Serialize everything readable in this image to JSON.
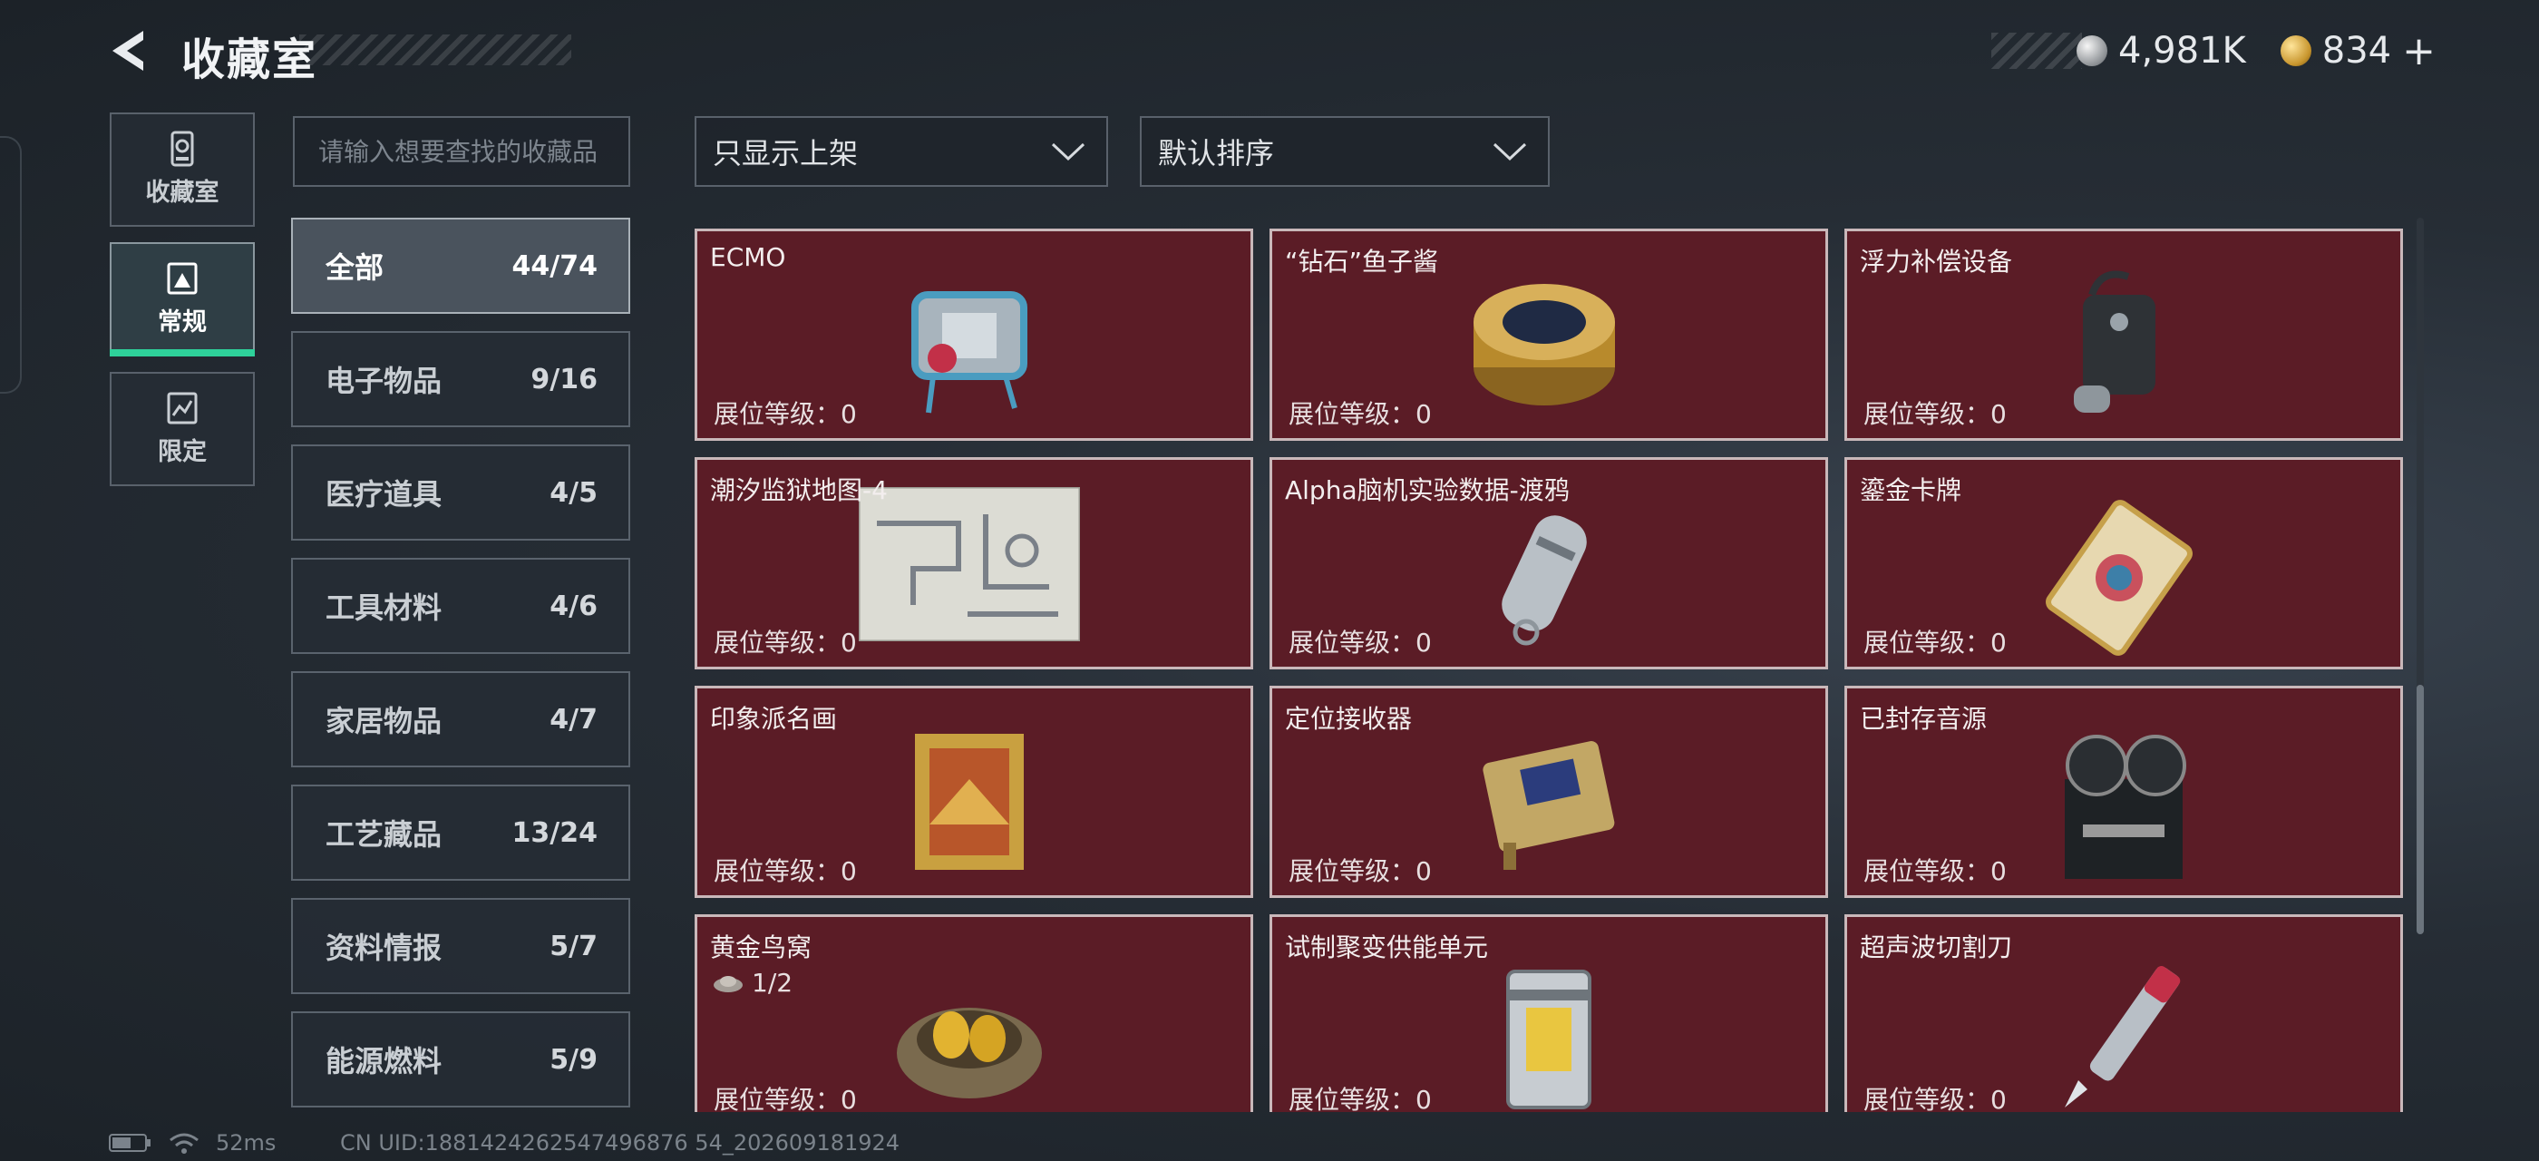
{
  "header": {
    "title": "收藏室",
    "currency": [
      {
        "icon": "silver-coin-icon",
        "value": "4,981K"
      },
      {
        "icon": "gold-coin-icon",
        "value": "834"
      }
    ],
    "add_symbol": "+"
  },
  "left_nav": [
    {
      "label": "收藏室",
      "icon": "collection-room-icon",
      "active": false
    },
    {
      "label": "常规",
      "icon": "regular-icon",
      "active": true
    },
    {
      "label": "限定",
      "icon": "limited-icon",
      "active": false
    }
  ],
  "search": {
    "placeholder": "请输入想要查找的收藏品",
    "value": ""
  },
  "categories": [
    {
      "name": "全部",
      "count": "44/74",
      "active": true
    },
    {
      "name": "电子物品",
      "count": "9/16"
    },
    {
      "name": "医疗道具",
      "count": "4/5"
    },
    {
      "name": "工具材料",
      "count": "4/6"
    },
    {
      "name": "家居物品",
      "count": "4/7"
    },
    {
      "name": "工艺藏品",
      "count": "13/24"
    },
    {
      "name": "资料情报",
      "count": "5/7"
    },
    {
      "name": "能源燃料",
      "count": "5/9"
    }
  ],
  "filters": {
    "listing": "只显示上架",
    "sort": "默认排序"
  },
  "level_label": "展位等级：0",
  "items": [
    {
      "name": "ECMO",
      "icon": "ecmo-machine-icon"
    },
    {
      "name": "“钻石”鱼子酱",
      "icon": "caviar-tin-icon"
    },
    {
      "name": "浮力补偿设备",
      "icon": "buoyancy-device-icon"
    },
    {
      "name": "潮汐监狱地图-4",
      "icon": "prison-map-icon"
    },
    {
      "name": "Alpha脑机实验数据-渡鸦",
      "icon": "data-capsule-icon"
    },
    {
      "name": "鎏金卡牌",
      "icon": "gilded-card-icon"
    },
    {
      "name": "印象派名画",
      "icon": "framed-painting-icon"
    },
    {
      "name": "定位接收器",
      "icon": "locator-receiver-icon"
    },
    {
      "name": "已封存音源",
      "icon": "reel-recorder-icon"
    },
    {
      "name": "黄金鸟窝",
      "icon": "golden-nest-icon",
      "sub": "1/2"
    },
    {
      "name": "试制聚变供能单元",
      "icon": "fusion-cell-icon"
    },
    {
      "name": "超声波切割刀",
      "icon": "ultrasonic-knife-icon"
    }
  ],
  "footer": {
    "ping": "52ms",
    "uid": "CN UID:1881424262547496876 54_202609181924"
  }
}
